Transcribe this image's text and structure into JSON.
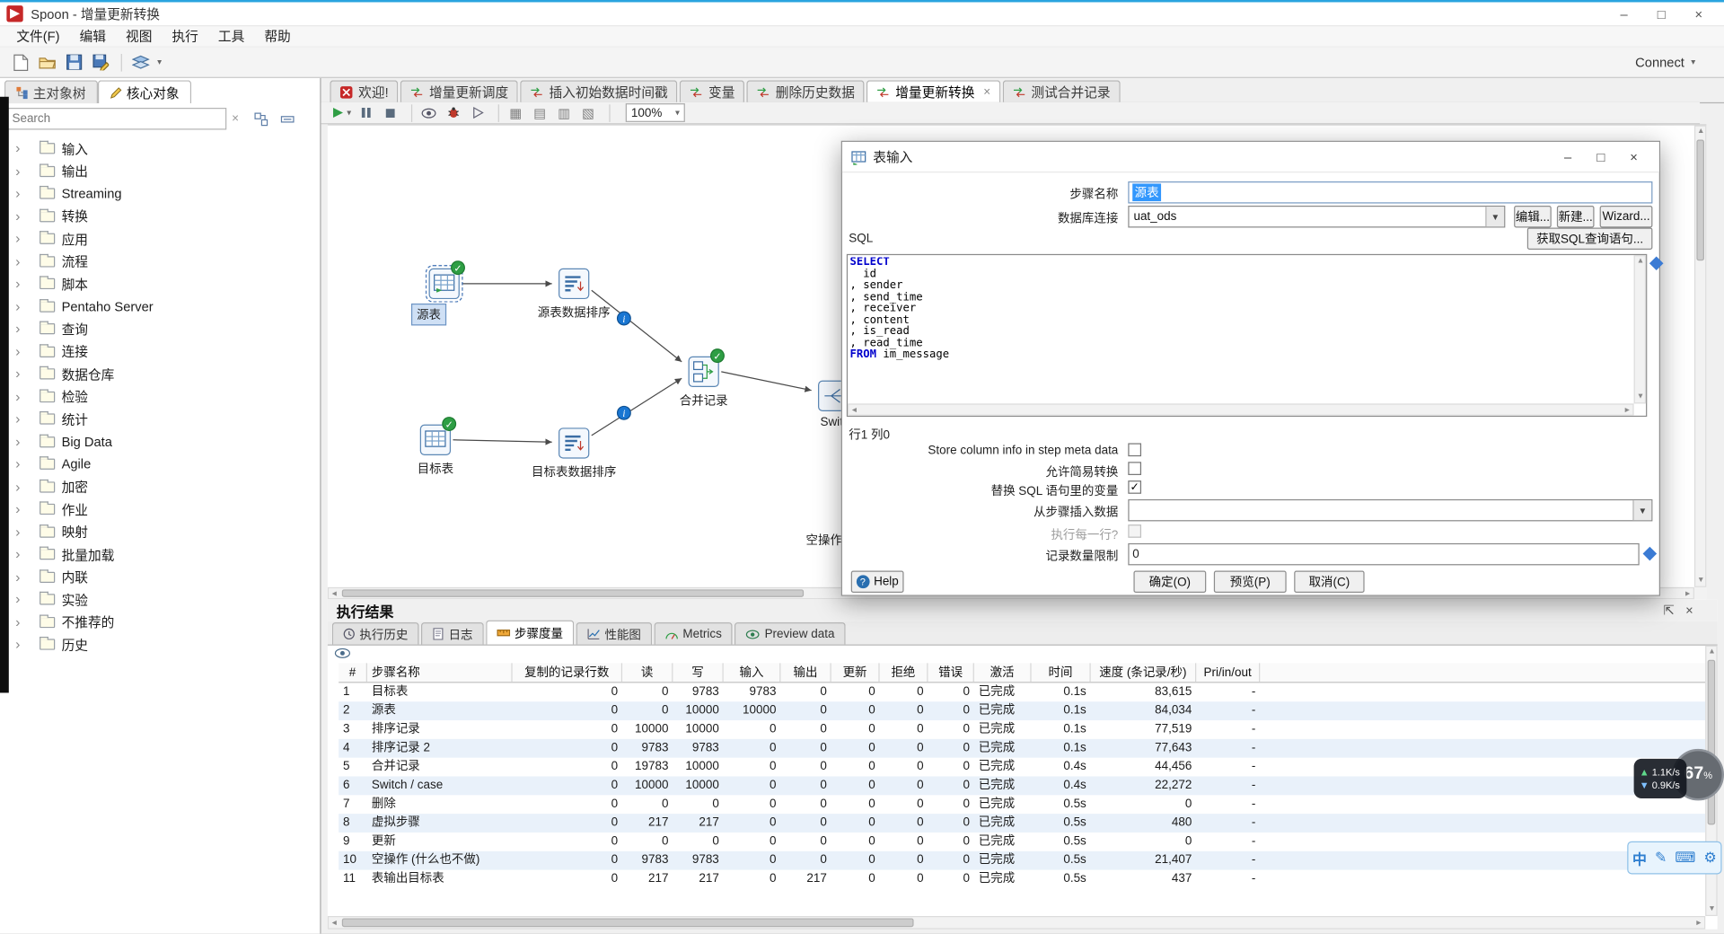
{
  "window": {
    "title": "Spoon - 增量更新转换",
    "menus": [
      "文件(F)",
      "编辑",
      "视图",
      "执行",
      "工具",
      "帮助"
    ],
    "connect_label": "Connect",
    "controls": {
      "minimize": "–",
      "maximize": "□",
      "close": "×"
    }
  },
  "sidebar": {
    "tabs": [
      "主对象树",
      "核心对象"
    ],
    "search_placeholder": "Search",
    "tree": [
      "输入",
      "输出",
      "Streaming",
      "转换",
      "应用",
      "流程",
      "脚本",
      "Pentaho Server",
      "查询",
      "连接",
      "数据仓库",
      "检验",
      "统计",
      "Big Data",
      "Agile",
      "加密",
      "作业",
      "映射",
      "批量加载",
      "内联",
      "实验",
      "不推荐的",
      "历史"
    ]
  },
  "doc_tabs": [
    {
      "label": "欢迎!",
      "active": false
    },
    {
      "label": "增量更新调度",
      "active": false
    },
    {
      "label": "插入初始数据时间戳",
      "active": false
    },
    {
      "label": "变量",
      "active": false
    },
    {
      "label": "删除历史数据",
      "active": false
    },
    {
      "label": "增量更新转换",
      "active": true
    },
    {
      "label": "测试合并记录",
      "active": false
    }
  ],
  "canvas": {
    "zoom": "100%",
    "steps": [
      {
        "label": "源表"
      },
      {
        "label": "源表数据排序"
      },
      {
        "label": "目标表"
      },
      {
        "label": "目标表数据排序"
      },
      {
        "label": "合并记录"
      },
      {
        "label": "Switch / case"
      },
      {
        "label": "空操作 (什么也不做)"
      }
    ]
  },
  "dialog": {
    "title": "表输入",
    "fields": {
      "step_name_label": "步骤名称",
      "step_name_value": "源表",
      "db_label": "数据库连接",
      "db_value": "uat_ods",
      "edit_button": "编辑...",
      "new_button": "新建...",
      "wizard_button": "Wizard...",
      "sql_label": "SQL",
      "get_sql_button": "获取SQL查询语句...",
      "cursor_pos": "行1 列0",
      "store_meta_label": "Store column info in step meta data",
      "lazy_label": "允许简易转换",
      "replace_vars_label": "替换 SQL 语句里的变量",
      "insert_data_label": "从步骤插入数据",
      "exec_each_row_label": "执行每一行?",
      "limit_label": "记录数量限制",
      "limit_value": "0"
    },
    "sql_keywords": [
      "SELECT",
      "FROM"
    ],
    "sql_lines": [
      "SELECT",
      "  id",
      ", sender",
      ", send_time",
      ", receiver",
      ", content",
      ", is_read",
      ", read_time",
      "FROM im_message"
    ],
    "buttons": {
      "help": "Help",
      "ok": "确定(O)",
      "preview": "预览(P)",
      "cancel": "取消(C)"
    }
  },
  "results": {
    "title": "执行结果",
    "tabs": [
      {
        "label": "执行历史",
        "active": false
      },
      {
        "label": "日志",
        "active": false
      },
      {
        "label": "步骤度量",
        "active": true
      },
      {
        "label": "性能图",
        "active": false
      },
      {
        "label": "Metrics",
        "active": false
      },
      {
        "label": "Preview data",
        "active": false
      }
    ],
    "columns": [
      "#",
      "步骤名称",
      "复制的记录行数",
      "读",
      "写",
      "输入",
      "输出",
      "更新",
      "拒绝",
      "错误",
      "激活",
      "时间",
      "速度 (条记录/秒)",
      "Pri/in/out"
    ],
    "rows": [
      [
        "1",
        "目标表",
        "0",
        "0",
        "9783",
        "9783",
        "0",
        "0",
        "0",
        "0",
        "已完成",
        "0.1s",
        "83,615",
        "-"
      ],
      [
        "2",
        "源表",
        "0",
        "0",
        "10000",
        "10000",
        "0",
        "0",
        "0",
        "0",
        "已完成",
        "0.1s",
        "84,034",
        "-"
      ],
      [
        "3",
        "排序记录",
        "0",
        "10000",
        "10000",
        "0",
        "0",
        "0",
        "0",
        "0",
        "已完成",
        "0.1s",
        "77,519",
        "-"
      ],
      [
        "4",
        "排序记录 2",
        "0",
        "9783",
        "9783",
        "0",
        "0",
        "0",
        "0",
        "0",
        "已完成",
        "0.1s",
        "77,643",
        "-"
      ],
      [
        "5",
        "合并记录",
        "0",
        "19783",
        "10000",
        "0",
        "0",
        "0",
        "0",
        "0",
        "已完成",
        "0.4s",
        "44,456",
        "-"
      ],
      [
        "6",
        "Switch / case",
        "0",
        "10000",
        "10000",
        "0",
        "0",
        "0",
        "0",
        "0",
        "已完成",
        "0.4s",
        "22,272",
        "-"
      ],
      [
        "7",
        "删除",
        "0",
        "0",
        "0",
        "0",
        "0",
        "0",
        "0",
        "0",
        "已完成",
        "0.5s",
        "0",
        "-"
      ],
      [
        "8",
        "虚拟步骤",
        "0",
        "217",
        "217",
        "0",
        "0",
        "0",
        "0",
        "0",
        "已完成",
        "0.5s",
        "480",
        "-"
      ],
      [
        "9",
        "更新",
        "0",
        "0",
        "0",
        "0",
        "0",
        "0",
        "0",
        "0",
        "已完成",
        "0.5s",
        "0",
        "-"
      ],
      [
        "10",
        "空操作 (什么也不做)",
        "0",
        "9783",
        "9783",
        "0",
        "0",
        "0",
        "0",
        "0",
        "已完成",
        "0.5s",
        "21,407",
        "-"
      ],
      [
        "11",
        "表输出目标表",
        "0",
        "217",
        "217",
        "0",
        "217",
        "0",
        "0",
        "0",
        "已完成",
        "0.5s",
        "437",
        "-"
      ]
    ]
  },
  "overlays": {
    "net_up": "1.1K/s",
    "net_down": "0.9K/s",
    "percent": "67",
    "percent_unit": "%",
    "ime_label": "中"
  }
}
